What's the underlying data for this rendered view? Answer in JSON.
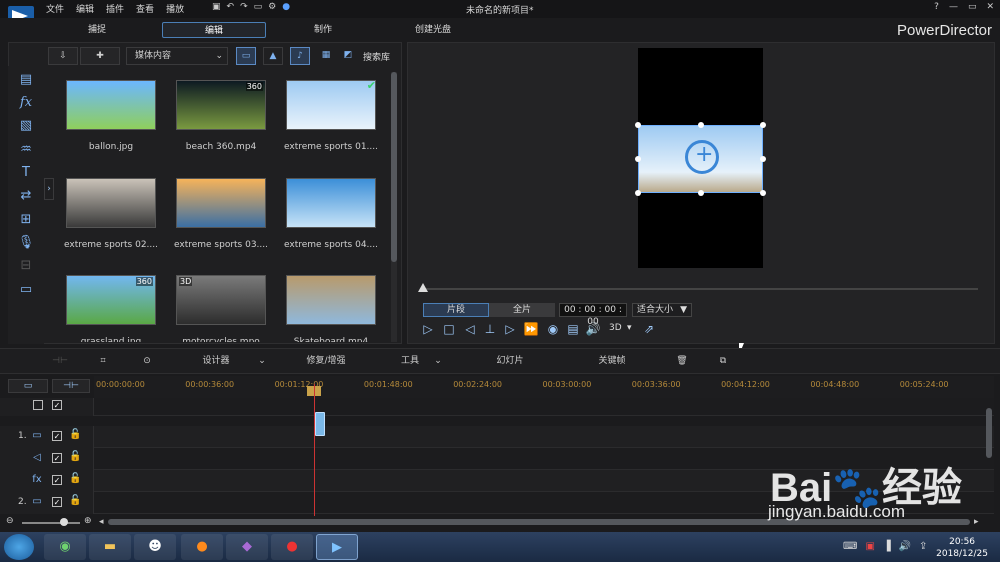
{
  "window": {
    "title": "未命名的新项目*",
    "menu": [
      "文件",
      "编辑",
      "插件",
      "查看",
      "播放"
    ],
    "controls": [
      "?",
      "—",
      "▭",
      "✕"
    ]
  },
  "tabs": [
    {
      "label": "捕捉",
      "active": false
    },
    {
      "label": "编辑",
      "active": true
    },
    {
      "label": "制作",
      "active": false
    },
    {
      "label": "创建光盘",
      "active": false
    }
  ],
  "brand": "PowerDirector",
  "library": {
    "dropdown": "媒体内容",
    "search_label": "搜索库",
    "items": [
      {
        "name": "ballon.jpg",
        "badge": "",
        "checked": false,
        "colors": [
          "#6cb7ff",
          "#8fcf5c"
        ]
      },
      {
        "name": "beach 360.mp4",
        "badge": "360",
        "checked": false,
        "colors": [
          "#0d1a22",
          "#7a9a40"
        ]
      },
      {
        "name": "extreme sports 01....",
        "badge": "",
        "checked": true,
        "colors": [
          "#9ecaf2",
          "#e9f3fb"
        ]
      },
      {
        "name": "extreme sports 02....",
        "badge": "",
        "checked": false,
        "colors": [
          "#c9c2b8",
          "#3a3a3a"
        ]
      },
      {
        "name": "extreme sports 03....",
        "badge": "",
        "checked": false,
        "colors": [
          "#f6b35a",
          "#3b6fa4"
        ]
      },
      {
        "name": "extreme sports 04....",
        "badge": "",
        "checked": false,
        "colors": [
          "#3c8fd8",
          "#c7e3f7"
        ]
      },
      {
        "name": "grassland.jpg",
        "badge": "360",
        "checked": false,
        "colors": [
          "#72b7f0",
          "#5aa845"
        ]
      },
      {
        "name": "motorcycles.mpo",
        "badge": "3D",
        "checked": false,
        "colors": [
          "#7a7a7a",
          "#2d2d2d"
        ]
      },
      {
        "name": "Skateboard.mp4",
        "badge": "",
        "checked": false,
        "colors": [
          "#b89a6c",
          "#8fb8dc"
        ]
      }
    ]
  },
  "preview": {
    "segment_label": "片段",
    "full_label": "全片",
    "timecode": "00 : 00 : 00 : 00",
    "fit": "适合大小",
    "mode3d": "3D"
  },
  "editbar": {
    "designer": "设计器",
    "repair": "修复/增强",
    "tools": "工具",
    "slideshow": "幻灯片",
    "keyframe": "关键帧"
  },
  "timeline": {
    "ticks": [
      "00:00:00:00",
      "00:00:36:00",
      "00:01:12:00",
      "00:01:48:00",
      "00:02:24:00",
      "00:03:00:00",
      "00:03:36:00",
      "00:04:12:00",
      "00:04:48:00",
      "00:05:24:00"
    ],
    "tracks": [
      "",
      "1.",
      "",
      "",
      "2."
    ]
  },
  "tray": {
    "time": "20:56",
    "date": "2018/12/25"
  },
  "watermark": {
    "main": "Bai🐾经验",
    "url": "jingyan.baidu.com"
  }
}
